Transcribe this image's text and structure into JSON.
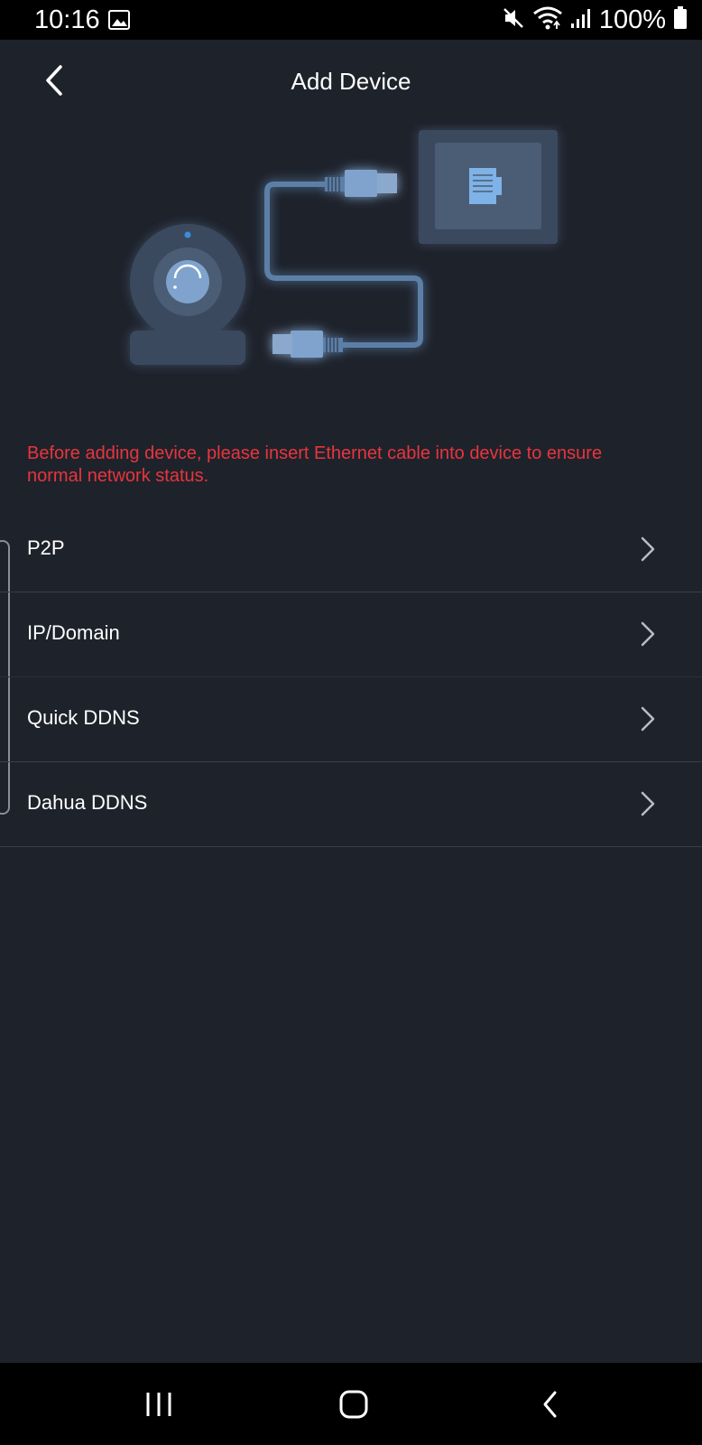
{
  "status_bar": {
    "time": "10:16",
    "battery": "100%",
    "icons": [
      "image-icon",
      "mute-icon",
      "wifi-icon",
      "signal-icon",
      "battery-icon"
    ]
  },
  "header": {
    "title": "Add Device",
    "back_icon": "chevron-left-icon"
  },
  "notice": "Before adding device, please insert Ethernet cable into device to ensure normal network status.",
  "menu": {
    "items": [
      {
        "label": "P2P"
      },
      {
        "label": "IP/Domain"
      },
      {
        "label": "Quick DDNS"
      },
      {
        "label": "Dahua DDNS"
      }
    ],
    "chevron_icon": "chevron-right-icon"
  },
  "nav_bar": {
    "icons": [
      "recent-apps-icon",
      "home-icon",
      "back-icon"
    ]
  },
  "colors": {
    "background": "#1e222b",
    "notice": "#e8353d",
    "illustration_primary": "#5b7fa8",
    "illustration_dark": "#3b4a5e"
  }
}
